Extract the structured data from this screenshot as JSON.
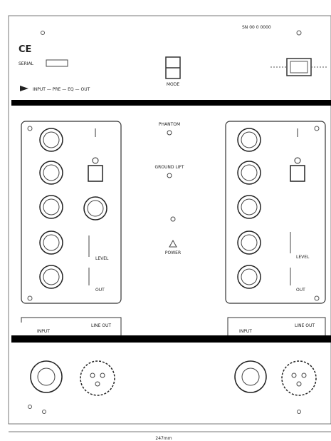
{
  "panel": {
    "ce_mark": "CE",
    "serial_label": "SERIAL",
    "model_label": "SN 00 0 0000",
    "mode_label": "MODE",
    "signal_chain_label": "INPUT — PRE — EQ — OUT",
    "center_top_label": "PHANTOM",
    "center_mid_label": "GROUND LIFT",
    "center_low_label": "POWER",
    "left_level_label": "LEVEL",
    "right_level_label": "LEVEL",
    "left_out_label": "OUT",
    "right_out_label": "OUT",
    "left_input_label": "INPUT",
    "left_output_label": "LINE OUT",
    "right_input_label": "INPUT",
    "right_output_label": "LINE OUT",
    "bottom_dimension": "247mm"
  }
}
